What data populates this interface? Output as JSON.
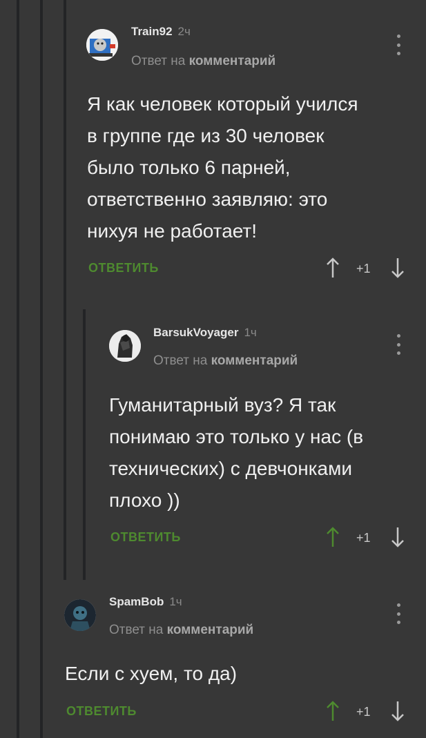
{
  "comments": [
    {
      "username": "Train92",
      "time": "2ч",
      "reply_prefix": "Ответ на",
      "reply_link": "комментарий",
      "text": "Я как человек который учился\nв группе где из 30 человек\nбыло только 6 парней,\nответственно заявляю: это\nнихуя не работает!",
      "reply_label": "ОТВЕТИТЬ",
      "rating": "+1",
      "avatar": "thomas-train-avatar"
    },
    {
      "username": "BarsukVoyager",
      "time": "1ч",
      "reply_prefix": "Ответ на",
      "reply_link": "комментарий",
      "text": "Гуманитарный вуз? Я так\nпонимаю это только у нас (в\nтехнических) с девчонками\nплохо ))",
      "reply_label": "ОТВЕТИТЬ",
      "rating": "+1",
      "avatar": "dark-figure-avatar"
    },
    {
      "username": "SpamBob",
      "time": "1ч",
      "reply_prefix": "Ответ на",
      "reply_link": "комментарий",
      "text": "Если с хуем, то да)",
      "reply_label": "ОТВЕТИТЬ",
      "rating": "+1",
      "avatar": "spambob-avatar"
    }
  ],
  "colors": {
    "background": "#373737",
    "thread_line": "#232426",
    "reply_green": "#4e8a2f",
    "upvote_green": "#4e8a2f"
  }
}
